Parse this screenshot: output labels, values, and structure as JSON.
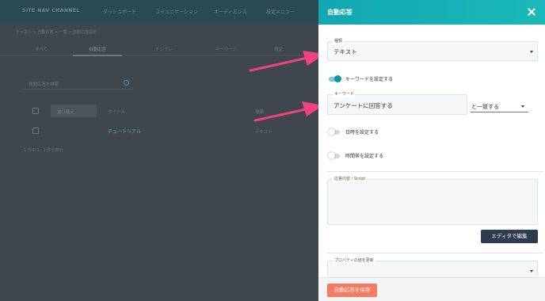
{
  "background": {
    "logo": "SITE NAV CHANNEL",
    "nav": [
      "ダッシュボード",
      "コミュニケーション",
      "オーディエンス",
      "設定メニュー"
    ],
    "breadcrumb": "チャネル > 自動応答 > 一覧 > 自動応答設定",
    "tabs": [
      "すべて",
      "自動応答",
      "テンプレ",
      "キーワード",
      "設定"
    ],
    "search_placeholder": "自動応答を検索",
    "table_headers": [
      "並び替え",
      "タイトル",
      "種類"
    ],
    "row": {
      "title": "チュートリアル",
      "type": "テキスト"
    },
    "footer": "1 件中 1 - 1 件を表示"
  },
  "drawer": {
    "title": "自動応答",
    "type_field": {
      "legend": "種類",
      "value": "テキスト"
    },
    "keyword_toggle": {
      "label": "キーワードを設定する",
      "on": true
    },
    "keyword_field": {
      "legend": "キーワード",
      "value": "アンケートに回答する"
    },
    "match_select": {
      "value": "と一致する"
    },
    "datetime_toggle": {
      "label": "日時を設定する",
      "on": false
    },
    "timeslot_toggle": {
      "label": "時間帯を設定する",
      "on": false
    },
    "response_field": {
      "legend": "応答内容 / Script",
      "value": ""
    },
    "editor_button": "エディタで編集",
    "property_field": {
      "legend": "プロパティの値を更新",
      "value": ""
    },
    "save_button": "自動応答を保存"
  },
  "colors": {
    "header_gradient_start": "#12a7b3",
    "header_gradient_end": "#1ab9b9",
    "save_button": "#f47b64",
    "editor_button": "#2d3d4f",
    "arrow": "#f0437d"
  },
  "icons": [
    "close-icon",
    "search-icon",
    "chevron-down-icon",
    "arrow-annotation"
  ]
}
